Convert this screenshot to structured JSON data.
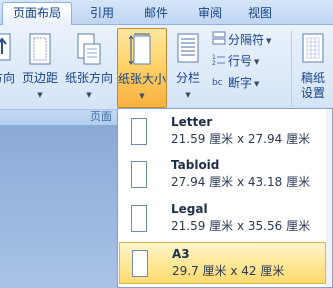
{
  "tabs": [
    {
      "label": "页面布局",
      "active": true
    },
    {
      "label": "引用",
      "active": false
    },
    {
      "label": "邮件",
      "active": false
    },
    {
      "label": "审阅",
      "active": false
    },
    {
      "label": "视图",
      "active": false
    }
  ],
  "ribbon": {
    "orientation_label": "方向",
    "margins_label": "页边距",
    "paper_orientation_label": "纸张方向",
    "paper_size_label": "纸张大小",
    "columns_label": "分栏",
    "breaks_label": "分隔符",
    "line_numbers_label": "行号",
    "hyphenation_label": "断字",
    "draft_paper_label_1": "稿纸",
    "draft_paper_label_2": "设置",
    "group_label": "页面"
  },
  "paper_sizes": [
    {
      "name": "Letter",
      "dims": "21.59 厘米 x 27.94 厘米",
      "selected": false
    },
    {
      "name": "Tabloid",
      "dims": "27.94 厘米 x 43.18 厘米",
      "selected": false
    },
    {
      "name": "Legal",
      "dims": "21.59 厘米 x 35.56 厘米",
      "selected": false
    },
    {
      "name": "A3",
      "dims": "29.7 厘米 x 42 厘米",
      "selected": true
    }
  ],
  "colors": {
    "accent_text": "#15428b",
    "highlight": "#ffd36a"
  }
}
